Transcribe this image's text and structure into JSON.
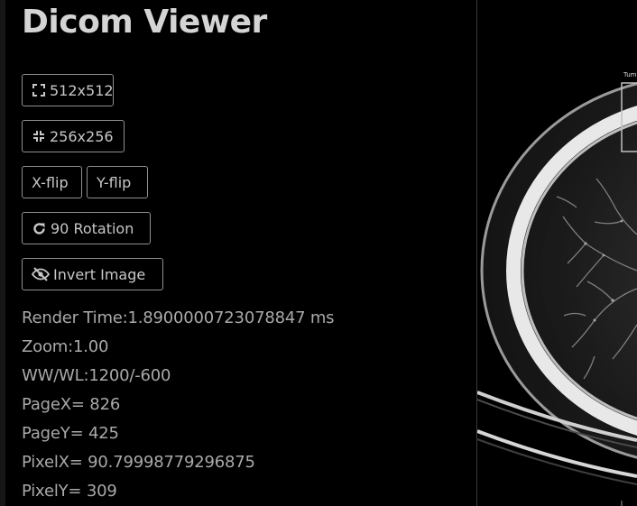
{
  "app": {
    "title": "Dicom Viewer"
  },
  "toolbar": {
    "size512_label": "512x512",
    "size256_label": "256x256",
    "xflip_label": "X-flip",
    "yflip_label": "Y-flip",
    "rotate_label": "90 Rotation",
    "invert_label": "Invert Image"
  },
  "info": {
    "render_time": "Render Time:1.8900000723078847 ms",
    "zoom": "Zoom:1.00",
    "wwwl": "WW/WL:1200/-600",
    "pagex": "PageX= 826",
    "pagey": "PageY= 425",
    "pixelx": "PixelX= 90.79998779296875",
    "pixely": "PixelY= 309"
  },
  "viewer": {
    "annotation_label": "Tum"
  },
  "icons": {
    "expand": "expand-icon",
    "compress": "compress-icon",
    "rotate": "rotate-icon",
    "invert": "eye-slash-icon"
  },
  "colors": {
    "background": "#000000",
    "button_border": "#8f8f8f",
    "title": "#d4d4d4",
    "text": "#a9a9a9"
  }
}
